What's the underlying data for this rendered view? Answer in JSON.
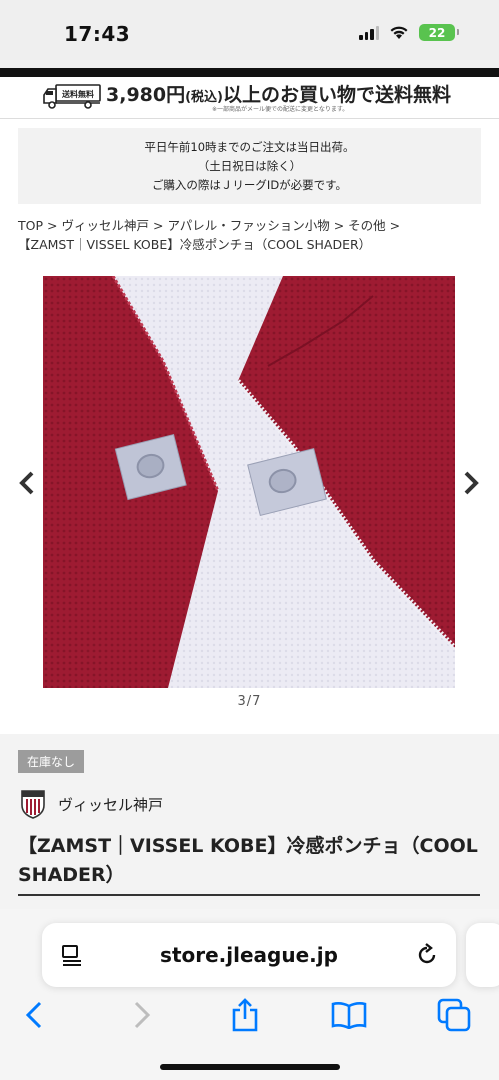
{
  "status": {
    "time": "17:43",
    "battery": "22"
  },
  "header": {
    "shipping_badge": "送料無料",
    "shipping_amount": "3,980円",
    "shipping_tax": "(税込)",
    "shipping_text": "以上のお買い物で送料無料",
    "shipping_note": "※一部商品がメール便での配送に変更となります。"
  },
  "notice": {
    "line1": "平日午前10時までのご注文は当日出荷。",
    "line2": "（土日祝日は除く）",
    "line3": "ご購入の際はＪリーグIDが必要です。"
  },
  "breadcrumb": {
    "items": [
      "TOP",
      "ヴィッセル神戸",
      "アパレル・ファッション小物",
      "その他"
    ],
    "separator": ">",
    "current": "【ZAMST｜VISSEL KOBE】冷感ポンチョ（COOL SHADER）"
  },
  "gallery": {
    "counter": "3/7"
  },
  "product": {
    "stock": "在庫なし",
    "club": "ヴィッセル神戸",
    "title": "【ZAMST｜VISSEL KOBE】冷感ポンチョ（COOL SHADER）"
  },
  "browser": {
    "url": "store.jleague.jp"
  },
  "colors": {
    "accent": "#007aff",
    "crimson": "#9e1b32",
    "battery": "#59c34f"
  },
  "icons": [
    "signal-icon",
    "wifi-icon",
    "battery-icon",
    "truck-icon",
    "chevron-left-icon",
    "chevron-right-icon",
    "club-logo-icon",
    "reader-mode-icon",
    "reload-icon",
    "back-icon",
    "forward-icon",
    "share-icon",
    "bookmarks-icon",
    "tabs-icon"
  ]
}
